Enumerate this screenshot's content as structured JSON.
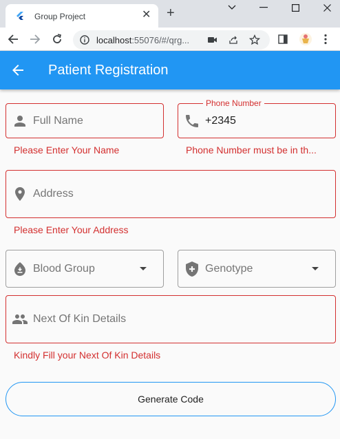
{
  "browser": {
    "tab_title": "Group Project",
    "tab_close": "✕",
    "new_tab": "+",
    "url_main": "localhost",
    "url_rest": ":55076/#/qrg..."
  },
  "appbar": {
    "title": "Patient Registration"
  },
  "form": {
    "full_name": {
      "hint": "Full Name",
      "error": "Please Enter Your Name"
    },
    "phone": {
      "label": "Phone Number",
      "value": "+2345",
      "error": "Phone Number must be in th..."
    },
    "address": {
      "hint": "Address",
      "error": "Please Enter Your Address"
    },
    "blood_group": {
      "hint": "Blood Group"
    },
    "genotype": {
      "hint": "Genotype"
    },
    "next_of_kin": {
      "hint": "Next Of Kin Details",
      "error": "Kindly Fill your Next Of Kin Details"
    }
  },
  "actions": {
    "generate_label": "Generate Code"
  },
  "colors": {
    "primary": "#2196f3",
    "error": "#d32f2f"
  }
}
